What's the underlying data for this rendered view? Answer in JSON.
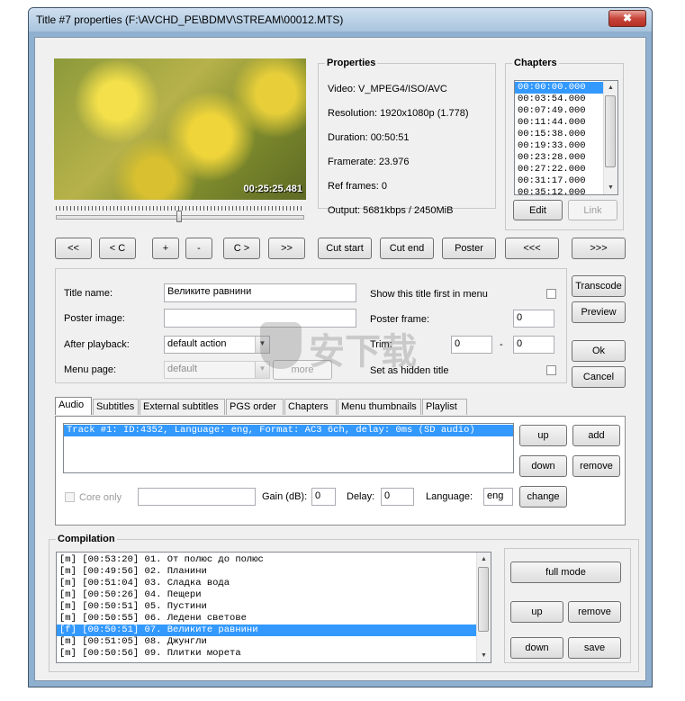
{
  "window": {
    "title": "Title #7 properties (F:\\AVCHD_PE\\BDMV\\STREAM\\00012.MTS)",
    "close_glyph": "✖"
  },
  "preview": {
    "timestamp": "00:25:25.481",
    "seek_position": 0.5
  },
  "properties": {
    "heading": "Properties",
    "video": "Video: V_MPEG4/ISO/AVC",
    "resolution": "Resolution: 1920x1080p (1.778)",
    "duration": "Duration: 00:50:51",
    "framerate": "Framerate: 23.976",
    "ref_frames": "Ref frames: 0",
    "output": "Output: 5681kbps / 2450MiB"
  },
  "chapters": {
    "heading": "Chapters",
    "items": [
      "00:00:00.000",
      "00:03:54.000",
      "00:07:49.000",
      "00:11:44.000",
      "00:15:38.000",
      "00:19:33.000",
      "00:23:28.000",
      "00:27:22.000",
      "00:31:17.000",
      "00:35:12.000"
    ],
    "selected_index": 0,
    "edit_label": "Edit",
    "link_label": "Link"
  },
  "nav_buttons": {
    "rewind_fast": "<<",
    "prev_chapter": "< C",
    "plus": "+",
    "minus": "-",
    "next_chapter": "C >",
    "forward_fast": ">>",
    "cut_start": "Cut start",
    "cut_end": "Cut end",
    "poster": "Poster",
    "prev_title": "<<<",
    "next_title": ">>>"
  },
  "form": {
    "title_name_label": "Title name:",
    "title_name_value": "Великите равнини",
    "poster_image_label": "Poster image:",
    "poster_image_value": "",
    "after_playback_label": "After playback:",
    "after_playback_value": "default action",
    "menu_page_label": "Menu page:",
    "menu_page_value": "default",
    "more_label": "more",
    "show_first_label": "Show this title first in menu",
    "poster_frame_label": "Poster frame:",
    "poster_frame_value": "0",
    "trim_label": "Trim:",
    "trim_start": "0",
    "trim_dash": "-",
    "trim_end": "0",
    "hidden_label": "Set as hidden title"
  },
  "side_buttons": {
    "transcode": "Transcode",
    "preview": "Preview",
    "ok": "Ok",
    "cancel": "Cancel"
  },
  "tabs": [
    "Audio",
    "Subtitles",
    "External subtitles",
    "PGS order",
    "Chapters",
    "Menu thumbnails",
    "Playlist"
  ],
  "audio": {
    "tracks": [
      "Track #1: ID:4352, Language: eng, Format: AC3 6ch, delay: 0ms (SD audio)"
    ],
    "up": "up",
    "add": "add",
    "down": "down",
    "remove": "remove",
    "core_only_label": "Core only",
    "core_value": "",
    "gain_label": "Gain (dB):",
    "gain_value": "0",
    "delay_label": "Delay:",
    "delay_value": "0",
    "language_label": "Language:",
    "language_value": "eng",
    "change": "change"
  },
  "compilation": {
    "heading": "Compilation",
    "items": [
      "[m] [00:53:20] 01. От полюс до полюс",
      "[m] [00:49:56] 02. Планини",
      "[m] [00:51:04] 03. Сладка вода",
      "[m] [00:50:26] 04. Пещери",
      "[m] [00:50:51] 05. Пустини",
      "[m] [00:50:55] 06. Ледени светове",
      "[f] [00:50:51] 07. Великите равнини",
      "[m] [00:51:05] 08. Джунгли",
      "[m] [00:50:56] 09. Плитки морета"
    ],
    "selected_index": 6,
    "full_mode": "full mode",
    "up": "up",
    "remove": "remove",
    "down": "down",
    "save": "save"
  },
  "watermark": "安下载"
}
